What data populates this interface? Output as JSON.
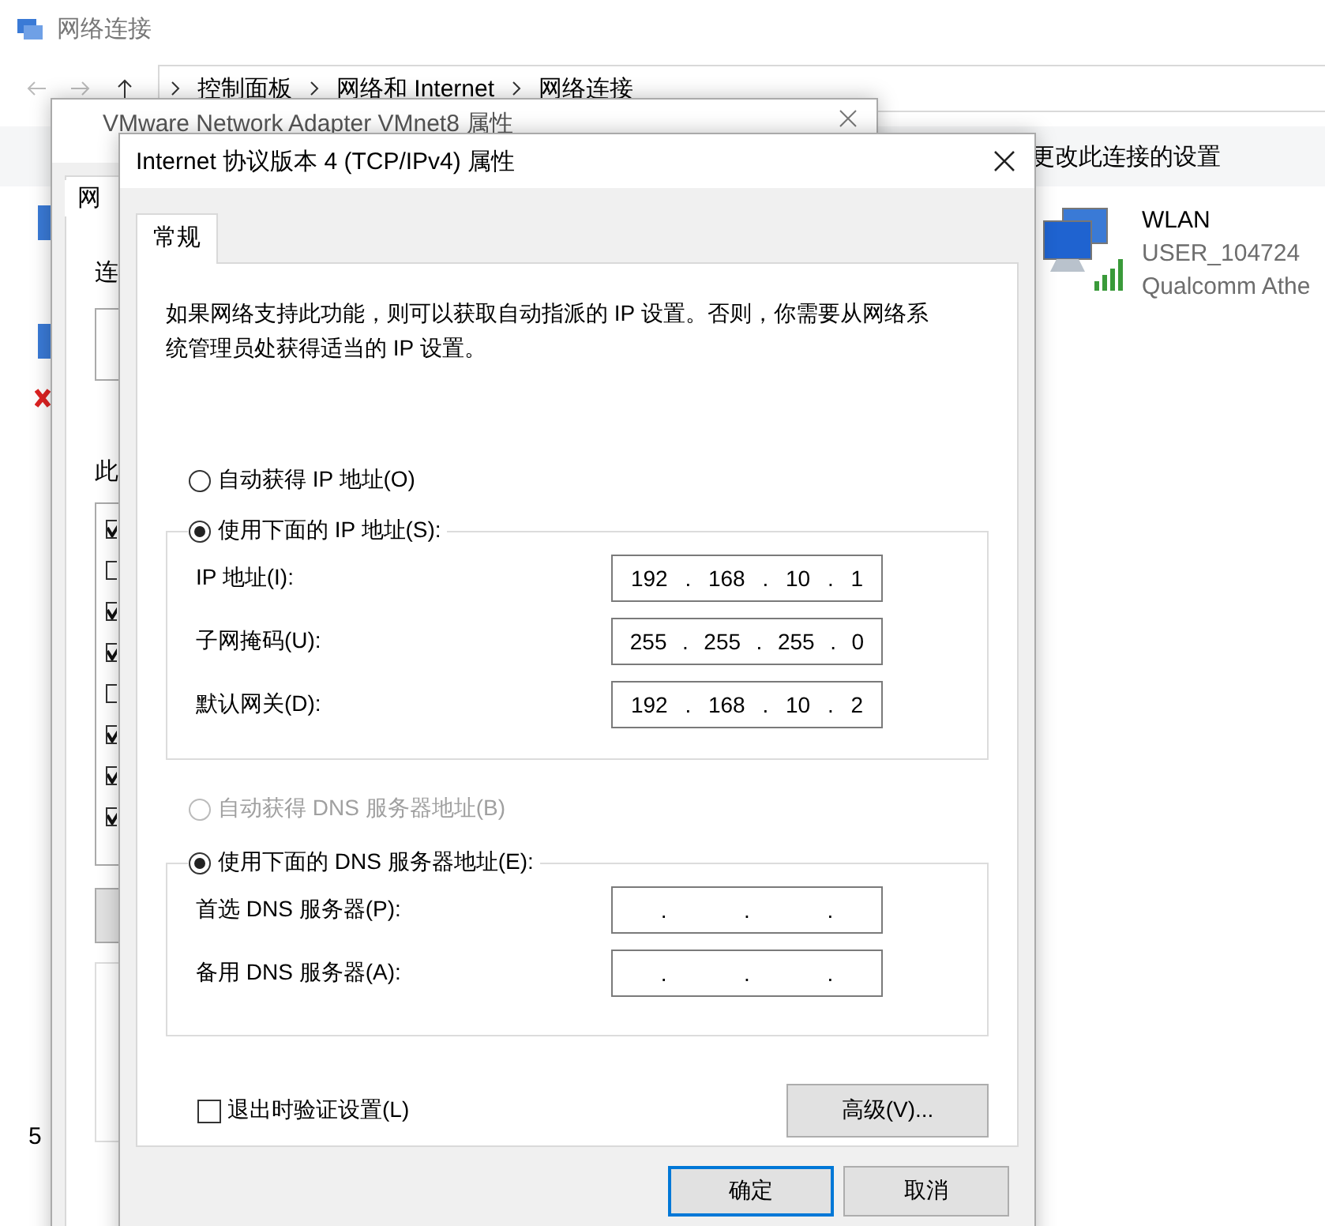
{
  "explorer": {
    "title": "网络连接",
    "breadcrumb": [
      "控制面板",
      "网络和 Internet",
      "网络连接"
    ],
    "toolbar_action": "更改此连接的设置",
    "connection": {
      "name": "WLAN",
      "network": "USER_104724",
      "adapter": "Qualcomm Athe"
    },
    "item_count": "5"
  },
  "adapter_dialog": {
    "title": "VMware Network Adapter VMnet8 属性",
    "tab": "网",
    "labels": [
      "连",
      "此"
    ],
    "items": [
      {
        "checked": true
      },
      {
        "checked": false
      },
      {
        "checked": true
      },
      {
        "checked": true
      },
      {
        "checked": false
      },
      {
        "checked": true
      },
      {
        "checked": true
      },
      {
        "checked": true
      }
    ]
  },
  "ipv4_dialog": {
    "title": "Internet 协议版本 4 (TCP/IPv4) 属性",
    "tabs": [
      {
        "label": "常规",
        "selected": true
      }
    ],
    "description": "如果网络支持此功能，则可以获取自动指派的 IP 设置。否则，你需要从网络系统管理员处获得适当的 IP 设置。",
    "ip_options": [
      {
        "label": "自动获得 IP 地址(O)",
        "selected": false,
        "disabled": false
      },
      {
        "label": "使用下面的 IP 地址(S):",
        "selected": true,
        "disabled": false
      }
    ],
    "ip_fields": [
      {
        "label": "IP 地址(I):",
        "parts": [
          "192",
          ".",
          "168",
          ".",
          "10",
          ".",
          "1"
        ]
      },
      {
        "label": "子网掩码(U):",
        "parts": [
          "255",
          ".",
          "255",
          ".",
          "255",
          ".",
          "0"
        ]
      },
      {
        "label": "默认网关(D):",
        "parts": [
          "192",
          ".",
          "168",
          ".",
          "10",
          ".",
          "2"
        ]
      }
    ],
    "dns_options": [
      {
        "label": "自动获得 DNS 服务器地址(B)",
        "selected": false,
        "disabled": true
      },
      {
        "label": "使用下面的 DNS 服务器地址(E):",
        "selected": true,
        "disabled": false
      }
    ],
    "dns_fields": [
      {
        "label": "首选 DNS 服务器(P):",
        "parts": [
          ".",
          ".",
          "."
        ]
      },
      {
        "label": "备用 DNS 服务器(A):",
        "parts": [
          ".",
          ".",
          "."
        ]
      }
    ],
    "validate": {
      "label": "退出时验证设置(L)",
      "checked": false
    },
    "advanced_button": "高级(V)...",
    "buttons": [
      "确定",
      "取消"
    ]
  }
}
